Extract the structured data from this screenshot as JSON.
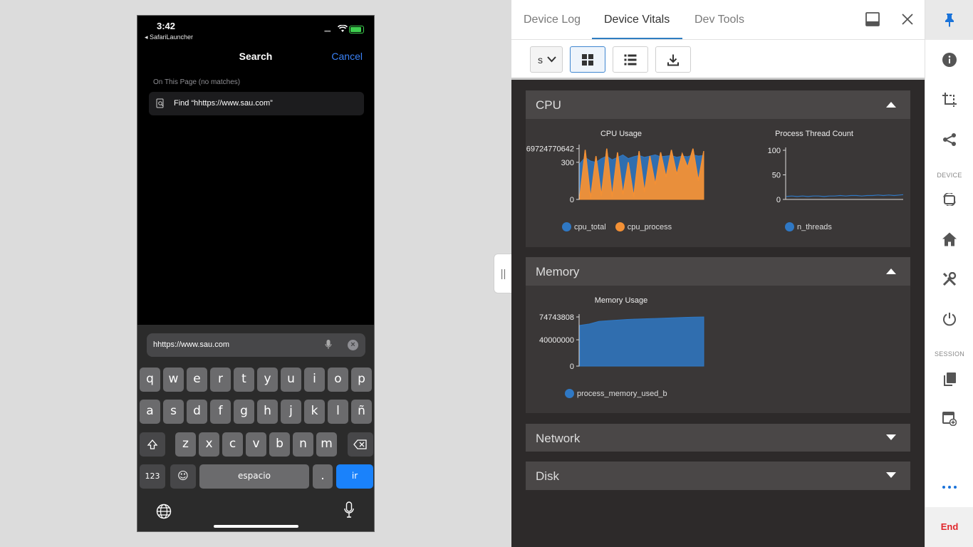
{
  "phone": {
    "time": "3:42",
    "back_app": "◂ SafariLauncher",
    "search_title": "Search",
    "cancel": "Cancel",
    "on_this_page": "On This Page (no matches)",
    "find_text": "Find “hhttps://www.sau.com”",
    "url_value": "hhttps://www.sau.com",
    "keyboard": {
      "row1": [
        "q",
        "w",
        "e",
        "r",
        "t",
        "y",
        "u",
        "i",
        "o",
        "p"
      ],
      "row2": [
        "a",
        "s",
        "d",
        "f",
        "g",
        "h",
        "j",
        "k",
        "l",
        "ñ"
      ],
      "row3": [
        "z",
        "x",
        "c",
        "v",
        "b",
        "n",
        "m"
      ],
      "num_key": "123",
      "space": "espacio",
      "period": ".",
      "go": "ir"
    }
  },
  "panel": {
    "tabs": [
      "Device Log",
      "Device Vitals",
      "Dev Tools"
    ],
    "active_tab": "Device Vitals",
    "select_value": "s",
    "sections": {
      "cpu": "CPU",
      "memory": "Memory",
      "network": "Network",
      "disk": "Disk"
    }
  },
  "chart_data": [
    {
      "type": "area",
      "title": "CPU Usage",
      "y_tick_labels": [
        "0",
        "300",
        "69724770642"
      ],
      "series": [
        {
          "name": "cpu_total",
          "color": "#2f78c4",
          "values": [
            290,
            340,
            310,
            300,
            330,
            350,
            320,
            340,
            360,
            330,
            345,
            355,
            340,
            350,
            360,
            345,
            350,
            355,
            340,
            350,
            345,
            360,
            350,
            355
          ]
        },
        {
          "name": "cpu_process",
          "color": "#f39035",
          "values": [
            20,
            400,
            10,
            350,
            30,
            410,
            20,
            380,
            40,
            300,
            20,
            390,
            60,
            350,
            120,
            380,
            180,
            400,
            200,
            370,
            260,
            410,
            150,
            390
          ]
        }
      ]
    },
    {
      "type": "line",
      "title": "Process Thread Count",
      "y_tick_labels": [
        "0",
        "50",
        "100"
      ],
      "ylim": [
        0,
        100
      ],
      "series": [
        {
          "name": "n_threads",
          "color": "#2f78c4",
          "values": [
            6,
            7,
            6,
            7,
            6,
            7,
            7,
            6,
            7,
            7,
            8,
            7,
            8,
            8,
            7,
            8,
            8,
            9,
            8,
            9,
            8,
            9,
            10,
            9
          ]
        }
      ]
    },
    {
      "type": "area",
      "title": "Memory Usage",
      "y_tick_labels": [
        "0",
        "40000000",
        "74743808"
      ],
      "ylim": [
        0,
        74743808
      ],
      "series": [
        {
          "name": "process_memory_used_b",
          "color": "#2f78c4",
          "values": [
            62000000,
            64000000,
            68000000,
            69000000,
            70000000,
            71000000,
            71500000,
            72000000,
            72500000,
            73000000,
            73500000,
            74000000,
            74500000,
            74743808
          ]
        }
      ]
    }
  ],
  "rail": {
    "device_label": "DEVICE",
    "session_label": "SESSION",
    "end": "End"
  }
}
